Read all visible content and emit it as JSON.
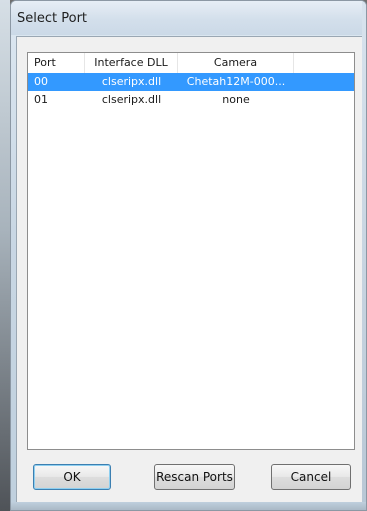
{
  "window": {
    "title": "Select Port"
  },
  "list": {
    "columns": [
      "Port",
      "Interface DLL",
      "Camera"
    ],
    "rows": [
      {
        "port": "00",
        "dll": "clseripx.dll",
        "camera": "Chetah12M-000...",
        "selected": true
      },
      {
        "port": "01",
        "dll": "clseripx.dll",
        "camera": "none",
        "selected": false
      }
    ]
  },
  "buttons": {
    "ok": "OK",
    "rescan": "Rescan Ports",
    "cancel": "Cancel"
  },
  "colors": {
    "selection": "#3399ff",
    "selection_text": "#ffffff",
    "default_button_border": "#3c7fb1"
  }
}
